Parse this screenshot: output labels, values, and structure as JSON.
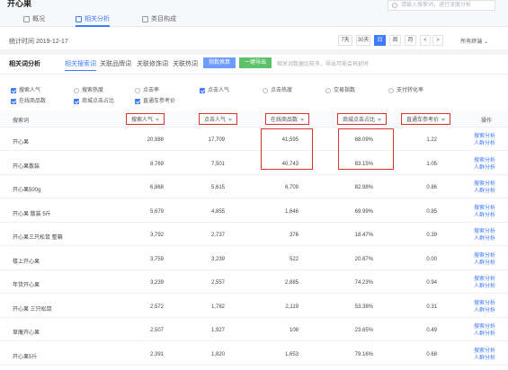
{
  "top": {
    "title": "开心果",
    "search_placeholder": "请输入搜索词，进行深度分析"
  },
  "tabs": [
    {
      "label": "概况",
      "active": false
    },
    {
      "label": "相关分析",
      "active": true
    },
    {
      "label": "类目构成",
      "active": false
    }
  ],
  "stat": {
    "date": "统计时间 2019-12-17",
    "ranges": [
      {
        "label": "7天",
        "active": false
      },
      {
        "label": "30天",
        "active": false
      },
      {
        "label": "日",
        "active": true
      },
      {
        "label": "周",
        "active": false
      },
      {
        "label": "月",
        "active": false
      },
      {
        "label": "<",
        "active": false
      },
      {
        "label": ">",
        "active": false
      }
    ],
    "terminal": "所有终端"
  },
  "analysis": {
    "title": "相关词分析",
    "subtabs": [
      {
        "label": "相关搜索词",
        "active": true
      },
      {
        "label": "关联品牌词",
        "active": false
      },
      {
        "label": "关联修饰词",
        "active": false
      },
      {
        "label": "关联热词",
        "active": false
      }
    ],
    "btn_compare": "指数换算",
    "btn_export": "一键导出",
    "note": "相关词数据比较多，导出可能会有延时"
  },
  "metrics": [
    {
      "label": "搜索人气",
      "checked": true
    },
    {
      "label": "搜索热度",
      "checked": false
    },
    {
      "label": "点击率",
      "checked": false
    },
    {
      "label": "点击人气",
      "checked": true
    },
    {
      "label": "点击热度",
      "checked": false
    },
    {
      "label": "交易指数",
      "checked": false
    },
    {
      "label": "支付转化率",
      "checked": false
    },
    {
      "label": "在线商品数",
      "checked": true
    },
    {
      "label": "商城点击占比",
      "checked": true
    },
    {
      "label": "直通车参考价",
      "checked": true
    }
  ],
  "table": {
    "headers": {
      "keyword": "搜索词",
      "search_pop": "搜索人气",
      "click_pop": "点击人气",
      "online_items": "在线商品数",
      "mall_click": "商城点击占比",
      "ztc_price": "直通车参考价",
      "ops": "操作"
    },
    "rows": [
      {
        "keyword": "开心果",
        "search_pop": "20,988",
        "click_pop": "17,709",
        "online_items": "41,595",
        "mall_click": "88.09%",
        "ztc_price": "1.22"
      },
      {
        "keyword": "开心果散装",
        "search_pop": "8,769",
        "click_pop": "7,501",
        "online_items": "40,743",
        "mall_click": "83.15%",
        "ztc_price": "1.05"
      },
      {
        "keyword": "开心果500g",
        "search_pop": "6,868",
        "click_pop": "5,615",
        "online_items": "6,709",
        "mall_click": "82.98%",
        "ztc_price": "0.86"
      },
      {
        "keyword": "开心果 散装 5斤",
        "search_pop": "5,679",
        "click_pop": "4,855",
        "online_items": "1,646",
        "mall_click": "69.99%",
        "ztc_price": "0.85"
      },
      {
        "keyword": "开心果三只松鼠 整箱",
        "search_pop": "3,792",
        "click_pop": "2,737",
        "online_items": "376",
        "mall_click": "18.47%",
        "ztc_price": "0.39"
      },
      {
        "keyword": "楼上开心果",
        "search_pop": "3,759",
        "click_pop": "3,239",
        "online_items": "522",
        "mall_click": "20.67%",
        "ztc_price": "0.00"
      },
      {
        "keyword": "年货开心果",
        "search_pop": "3,239",
        "click_pop": "2,557",
        "online_items": "2,885",
        "mall_click": "74.23%",
        "ztc_price": "0.94"
      },
      {
        "keyword": "开心果 三只松鼠",
        "search_pop": "2,572",
        "click_pop": "1,782",
        "online_items": "2,119",
        "mall_click": "53.38%",
        "ztc_price": "0.31"
      },
      {
        "keyword": "草庵开心果",
        "search_pop": "2,507",
        "click_pop": "1,927",
        "online_items": "108",
        "mall_click": "23.65%",
        "ztc_price": "0.49"
      },
      {
        "keyword": "开心果5斤",
        "search_pop": "2,391",
        "click_pop": "1,820",
        "online_items": "1,653",
        "mall_click": "79.16%",
        "ztc_price": "0.68"
      }
    ],
    "op_search": "搜索分析",
    "op_crowd": "人群分析"
  }
}
